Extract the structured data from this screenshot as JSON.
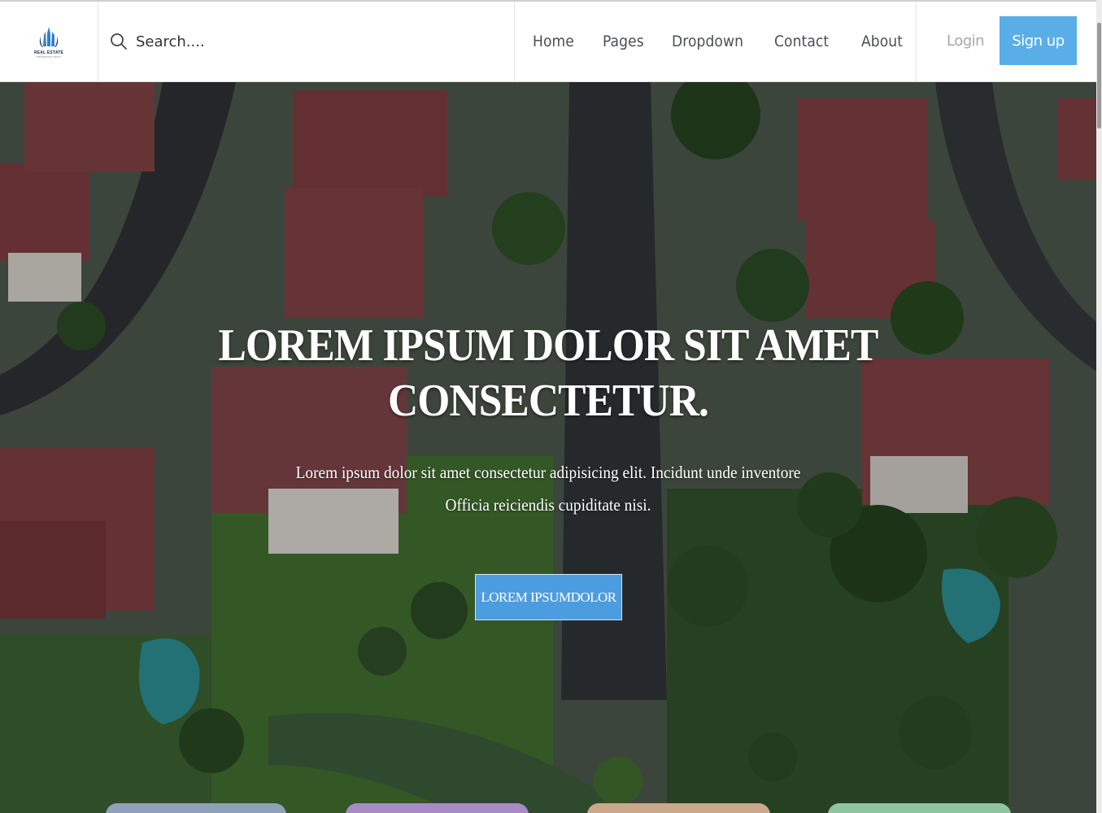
{
  "brand": {
    "name": "REAL ESTATE",
    "tagline": "PROPERTIES TRUST"
  },
  "search": {
    "placeholder": "Search...."
  },
  "nav": {
    "items": [
      {
        "label": "Home"
      },
      {
        "label": "Pages"
      },
      {
        "label": "Dropdown"
      },
      {
        "label": "Contact"
      },
      {
        "label": "About"
      }
    ],
    "login_label": "Login",
    "signup_label": "Sign up"
  },
  "hero": {
    "headline_line1": "LOREM IPSUM DOLOR SIT AMET",
    "headline_line2": "CONSECTETUR.",
    "sub_line1": "Lorem ipsum dolor sit amet consectetur adipisicing elit. Incidunt unde inventore",
    "sub_line2": "Officia reiciendis cupiditate nisi.",
    "cta_label": "LOREM IPSUMDOLOR"
  },
  "colors": {
    "accent": "#5aaee8",
    "cta": "#4c9de0",
    "nav_text": "#4a4f55",
    "login_text": "#a3a7ab",
    "card_tabs": [
      "#8fa1b8",
      "#a88bc4",
      "#c9a88c",
      "#8fc4a0"
    ]
  },
  "icons": {
    "search": "search-icon",
    "logo": "building-logo-icon"
  }
}
